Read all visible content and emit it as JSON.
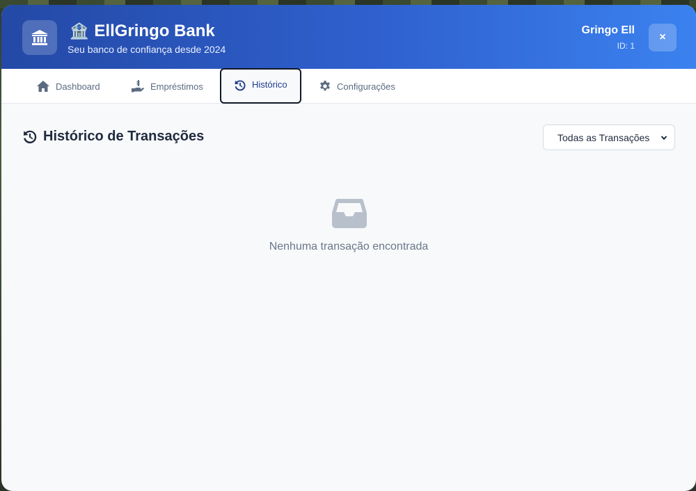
{
  "app": {
    "title": "EllGringo Bank",
    "title_emoji": "🏦",
    "subtitle": "Seu banco de confiança desde 2024"
  },
  "user": {
    "name": "Gringo Ell",
    "id_label": "ID: 1"
  },
  "header": {
    "close_label": "×",
    "gradient_start": "#2449a6",
    "gradient_end": "#3b82ef"
  },
  "tabs": [
    {
      "label": "Dashboard",
      "icon": "home-icon",
      "active": false
    },
    {
      "label": "Empréstimos",
      "icon": "hand-money-icon",
      "active": false
    },
    {
      "label": "Histórico",
      "icon": "history-icon",
      "active": true
    },
    {
      "label": "Configurações",
      "icon": "gear-icon",
      "active": false
    }
  ],
  "history": {
    "title": "Histórico de Transações",
    "filter": {
      "selected": "Todas as Transações"
    },
    "empty_message": "Nenhuma transação encontrada"
  }
}
